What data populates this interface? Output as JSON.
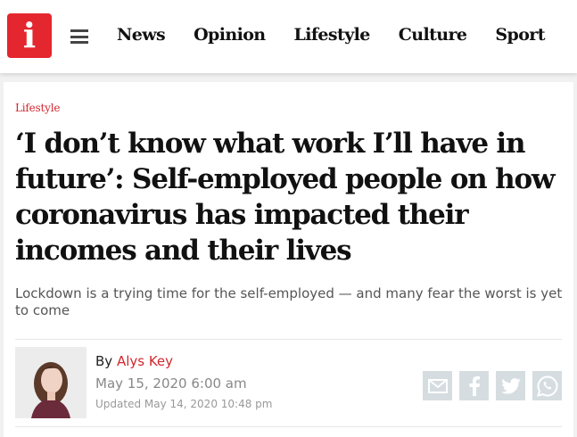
{
  "header": {
    "logo_text": "i",
    "nav": [
      "News",
      "Opinion",
      "Lifestyle",
      "Culture",
      "Sport"
    ]
  },
  "article": {
    "section": "Lifestyle",
    "headline": "‘I don’t know what work I’ll have in future’: Self-employed people on how coronavirus has impacted their incomes and their lives",
    "standfirst": "Lockdown is a trying time for the self-employed — and many fear the worst is yet to come",
    "byline_prefix": "By",
    "author": "Alys Key",
    "date": "May 15, 2020 6:00 am",
    "updated": "Updated May 14, 2020 10:48 pm"
  },
  "share": {
    "icons": [
      "email-icon",
      "facebook-icon",
      "twitter-icon",
      "whatsapp-icon"
    ]
  },
  "colors": {
    "brand": "#e4262f",
    "accent_text": "#d2262d",
    "share_bg": "#d6dde1"
  }
}
